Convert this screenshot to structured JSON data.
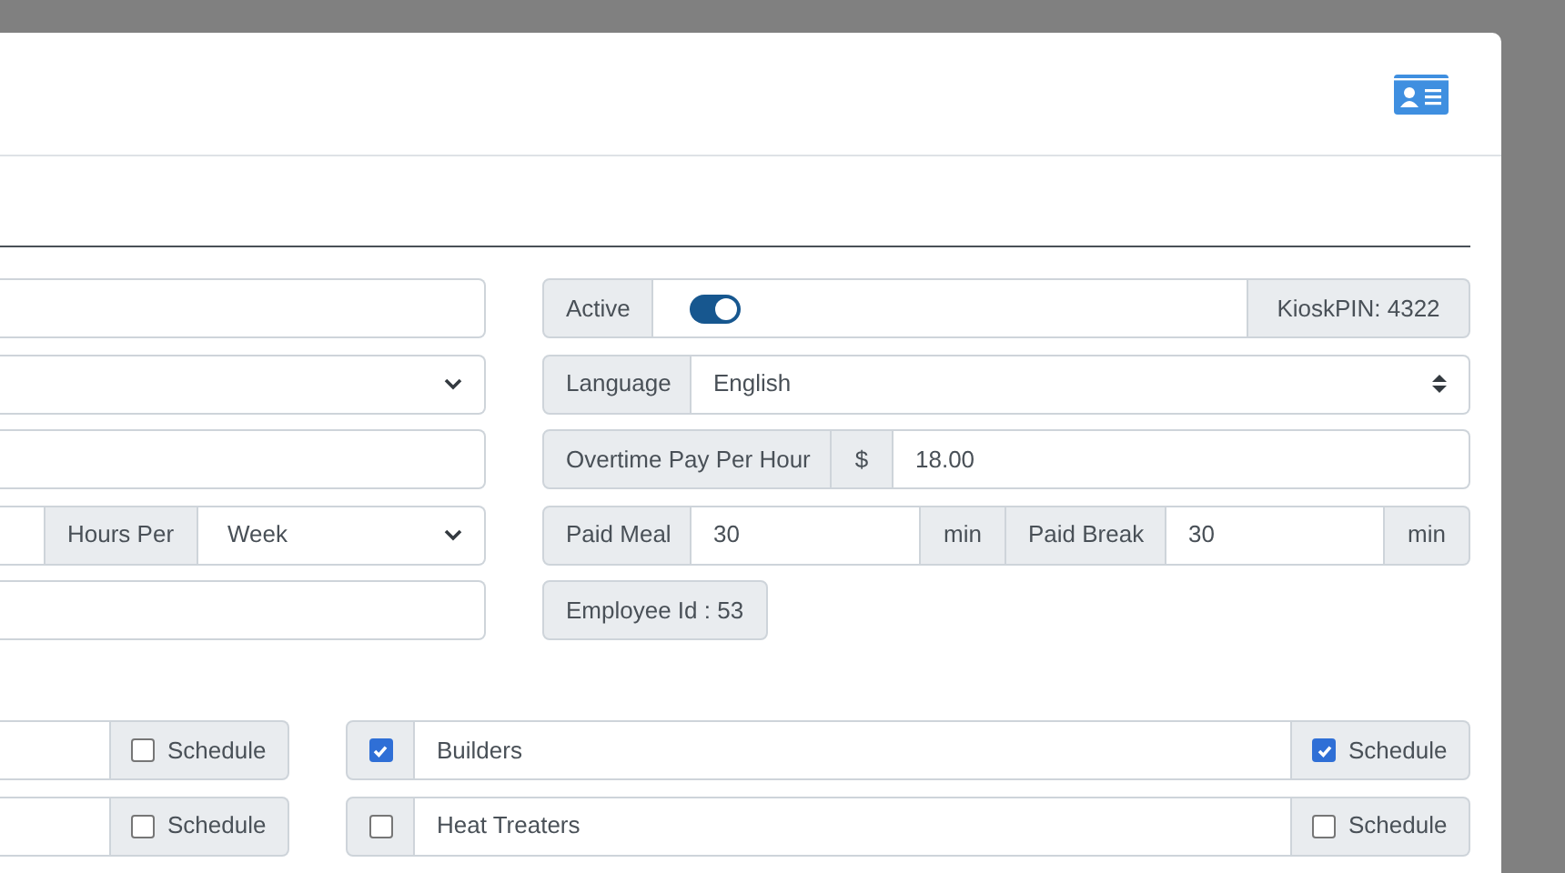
{
  "left_rows": [
    {
      "kind": "text"
    },
    {
      "kind": "select"
    },
    {
      "kind": "text"
    },
    {
      "kind": "hours",
      "addon": "Hours Per",
      "value": "Week"
    },
    {
      "kind": "text"
    }
  ],
  "active": {
    "label": "Active",
    "on": true,
    "pin": "KioskPIN: 4322"
  },
  "language": {
    "label": "Language",
    "value": "English"
  },
  "overtime": {
    "label": "Overtime Pay Per Hour",
    "currency": "$",
    "value": "18.00"
  },
  "paid": [
    {
      "label": "Paid Meal",
      "value": "30",
      "unit": "min"
    },
    {
      "label": "Paid Break",
      "value": "30",
      "unit": "min"
    }
  ],
  "employee_id": "Employee Id : 53",
  "groups_left": [
    {
      "schedule_label": "Schedule",
      "schedule": false
    },
    {
      "schedule_label": "Schedule",
      "schedule": false
    }
  ],
  "groups_right": [
    {
      "name": "Builders",
      "checked": true,
      "schedule_label": "Schedule",
      "schedule": true
    },
    {
      "name": "Heat Treaters",
      "checked": false,
      "schedule_label": "Schedule",
      "schedule": false
    }
  ]
}
